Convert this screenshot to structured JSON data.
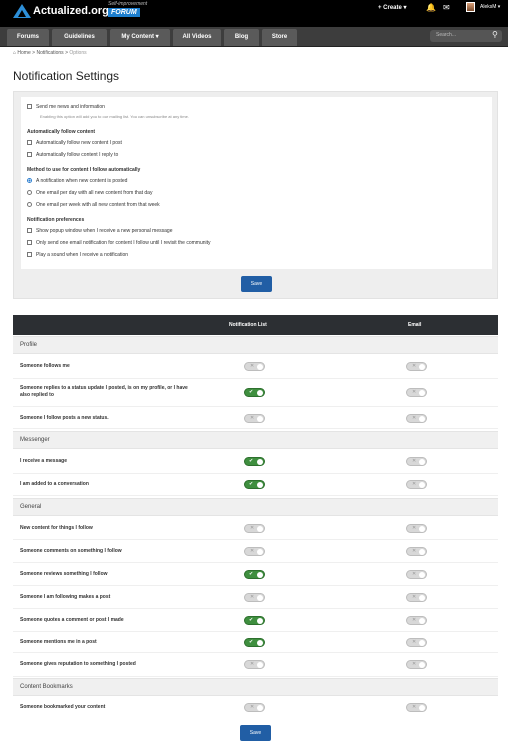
{
  "header": {
    "logo_text": "Actualized.org",
    "logo_sub": "Self-improvement",
    "logo_badge": "FORUM",
    "create_label": "+ Create ▾",
    "bell_icon": "bell-icon",
    "mail_icon": "mail-icon",
    "username": "AleksM ▾"
  },
  "nav": {
    "tabs": [
      "Forums",
      "Guidelines",
      "My Content ▾",
      "All Videos",
      "Blog",
      "Store"
    ],
    "search_placeholder": "Search...",
    "search_icon": "search-icon"
  },
  "breadcrumb": {
    "home": "⌂ Home",
    "sep1": ">",
    "notifications": "Notifications",
    "sep2": ">",
    "options": "Options"
  },
  "page": {
    "title": "Notification Settings"
  },
  "options": {
    "news_label": "Send me news and information",
    "news_hint": "Enabling this option will add you to our mailing list. You can unsubscribe at any time.",
    "auto_follow_heading": "Automatically follow content",
    "auto_follow_post": "Automatically follow new content I post",
    "auto_follow_reply": "Automatically follow content I reply to",
    "method_heading": "Method to use for content I follow automatically",
    "method_immediate": "A notification when new content is posted",
    "method_daily": "One email per day with all new content from that day",
    "method_weekly": "One email per week with all new content from that week",
    "prefs_heading": "Notification preferences",
    "pref_popup": "Show popup window when I receive a new personal message",
    "pref_one_email": "Only send one email notification for content I follow until I revisit the community",
    "pref_sound": "Play a sound when I receive a notification",
    "save_label": "Save"
  },
  "table": {
    "col_list": "Notification List",
    "col_email": "Email",
    "groups": {
      "profile": "Profile",
      "messenger": "Messenger",
      "general": "General",
      "bookmarks": "Content Bookmarks"
    },
    "rows": [
      {
        "label": "Someone follows me",
        "list": false,
        "email": false
      },
      {
        "label": "Someone replies to a status update I posted, is on my profile, or I have also replied to",
        "list": true,
        "email": false
      },
      {
        "label": "Someone I follow posts a new status.",
        "list": false,
        "email": false
      },
      {
        "label": "I receive a message",
        "list": true,
        "email": false
      },
      {
        "label": "I am added to a conversation",
        "list": true,
        "email": false
      },
      {
        "label": "New content for things I follow",
        "list": false,
        "email": false
      },
      {
        "label": "Someone comments on something I follow",
        "list": false,
        "email": false
      },
      {
        "label": "Someone reviews something I follow",
        "list": true,
        "email": false
      },
      {
        "label": "Someone I am following makes a post",
        "list": false,
        "email": false
      },
      {
        "label": "Someone quotes a comment or post I made",
        "list": true,
        "email": false
      },
      {
        "label": "Someone mentions me in a post",
        "list": true,
        "email": false
      },
      {
        "label": "Someone gives reputation to something I posted",
        "list": false,
        "email": false
      },
      {
        "label": "Someone bookmarked your content",
        "list": false,
        "email": false
      }
    ],
    "save_label": "Save",
    "on_mark": "✔",
    "off_mark": "✕"
  },
  "colors": {
    "accent": "#215ea5",
    "toggle_on": "#3f8f3f",
    "header_bg": "#000000",
    "table_head": "#2c2f33"
  }
}
